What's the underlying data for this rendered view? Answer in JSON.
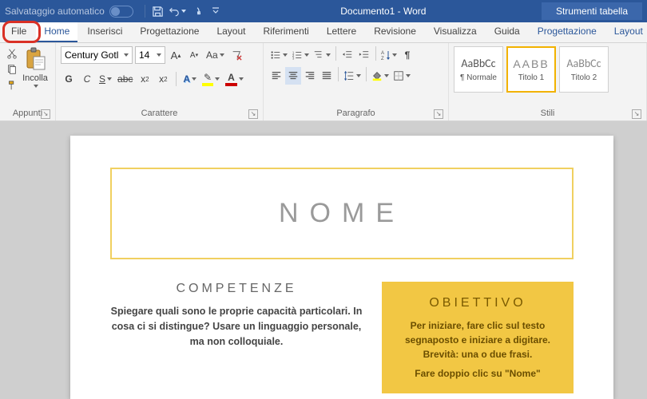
{
  "titlebar": {
    "autosave": "Salvataggio automatico",
    "doc": "Documento1 - Word",
    "tool_context": "Strumenti tabella"
  },
  "tabs": {
    "file": "File",
    "home": "Home",
    "inserisci": "Inserisci",
    "progettazione": "Progettazione",
    "layout": "Layout",
    "riferimenti": "Riferimenti",
    "lettere": "Lettere",
    "revisione": "Revisione",
    "visualizza": "Visualizza",
    "guida": "Guida",
    "t_progettazione": "Progettazione",
    "t_layout": "Layout"
  },
  "ribbon": {
    "clipboard": {
      "label": "Appunti",
      "paste": "Incolla"
    },
    "font": {
      "label": "Carattere",
      "name": "Century Gotl",
      "size": "14",
      "bold": "G",
      "italic": "C",
      "underline": "S"
    },
    "paragraph": {
      "label": "Paragrafo"
    },
    "styles": {
      "label": "Stili",
      "items": [
        {
          "sample": "AaBbCc",
          "name": "¶ Normale"
        },
        {
          "sample": "AABB",
          "name": "Titolo 1"
        },
        {
          "sample": "AaBbCc",
          "name": "Titolo 2"
        }
      ]
    }
  },
  "document": {
    "name": "NOME",
    "left": {
      "h": "COMPETENZE",
      "p": "Spiegare quali sono le proprie capacità particolari. In cosa ci si distingue? Usare un linguaggio personale, ma non colloquiale."
    },
    "right": {
      "h": "OBIETTIVO",
      "p1": "Per iniziare, fare clic sul testo segnaposto e iniziare a digitare. Brevità: una o due frasi.",
      "p2": "Fare doppio clic su \"Nome\""
    }
  }
}
